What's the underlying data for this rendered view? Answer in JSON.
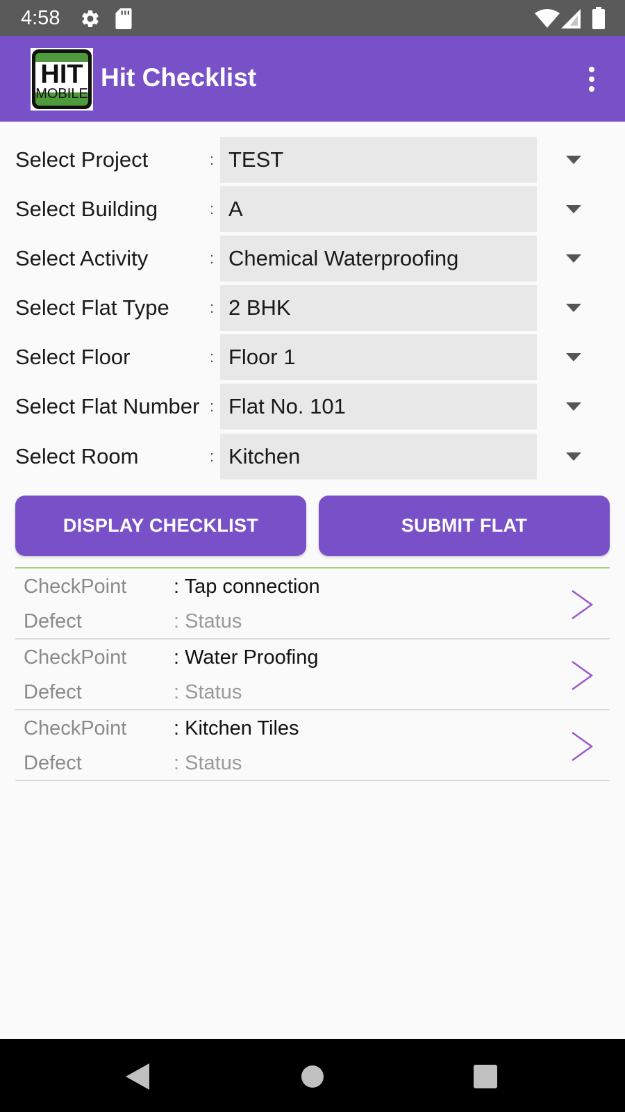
{
  "status_bar": {
    "time": "4:58",
    "icons": [
      "gear-icon",
      "sd-card-icon",
      "wifi-icon",
      "cell-signal-icon",
      "battery-icon"
    ]
  },
  "app_bar": {
    "logo_text_top": "HIT",
    "logo_text_bottom": "MOBILE",
    "title": "Hit Checklist",
    "menu_icon": "more-vert-icon"
  },
  "form": {
    "separator": ":",
    "rows": [
      {
        "label": "Select Project",
        "value": "TEST"
      },
      {
        "label": "Select Building",
        "value": "A"
      },
      {
        "label": "Select Activity",
        "value": "Chemical Waterproofing"
      },
      {
        "label": "Select Flat Type",
        "value": "2 BHK"
      },
      {
        "label": "Select Floor",
        "value": "Floor 1"
      },
      {
        "label": "Select Flat Number",
        "value": "Flat No. 101"
      },
      {
        "label": "Select Room",
        "value": "Kitchen"
      }
    ]
  },
  "buttons": {
    "display_checklist": "DISPLAY CHECKLIST",
    "submit_flat": "SUBMIT FLAT"
  },
  "checklist": {
    "items": [
      {
        "checkpoint_label": "CheckPoint",
        "checkpoint_value": ": Tap connection",
        "defect_label": "Defect",
        "defect_value": ": Status"
      },
      {
        "checkpoint_label": "CheckPoint",
        "checkpoint_value": ": Water Proofing",
        "defect_label": "Defect",
        "defect_value": ": Status"
      },
      {
        "checkpoint_label": "CheckPoint",
        "checkpoint_value": ": Kitchen Tiles",
        "defect_label": "Defect",
        "defect_value": ": Status"
      }
    ]
  },
  "colors": {
    "primary": "#7851c9",
    "status_bar": "#5a5a5a",
    "background": "#fafafa",
    "select_bg": "#e8e8e8",
    "list_accent_line": "#a6cf7c",
    "chevron": "#9b59c8"
  },
  "nav_bar": {
    "icons": [
      "back-icon",
      "home-icon",
      "recents-icon"
    ]
  }
}
